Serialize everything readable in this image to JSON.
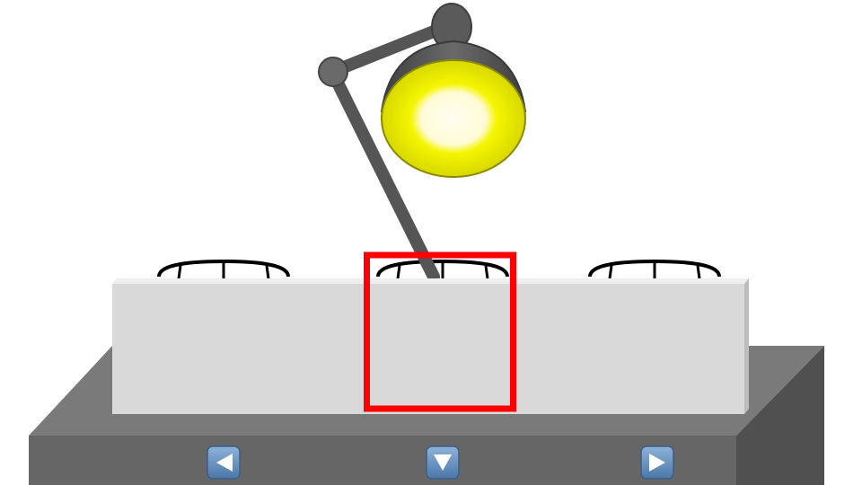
{
  "scene": {
    "background_color": "#ffffff",
    "lamp": {
      "state": "on",
      "arm_color": "#555555",
      "shade_color": "#5a5a5a",
      "bulb_color": "#f5f500",
      "glow_color": "#fffbd6"
    },
    "table": {
      "top_color": "#7a7a7a",
      "front_color": "#666666",
      "side_color": "#505050"
    },
    "screen": {
      "front_color": "#d9d9d9",
      "top_color": "#eeeeee",
      "side_color": "#bdbdbd"
    },
    "cups": [
      {
        "name": "left"
      },
      {
        "name": "middle"
      },
      {
        "name": "right"
      }
    ],
    "selected_cup": 1,
    "selection_color": "#ff0000"
  },
  "controls": {
    "buttons": [
      {
        "name": "left-arrow-button",
        "icon": "triangle-left-icon"
      },
      {
        "name": "down-arrow-button",
        "icon": "triangle-down-icon"
      },
      {
        "name": "right-arrow-button",
        "icon": "triangle-right-icon"
      }
    ],
    "button_color": "#5f8fc0",
    "icon_color": "#ffffff"
  }
}
